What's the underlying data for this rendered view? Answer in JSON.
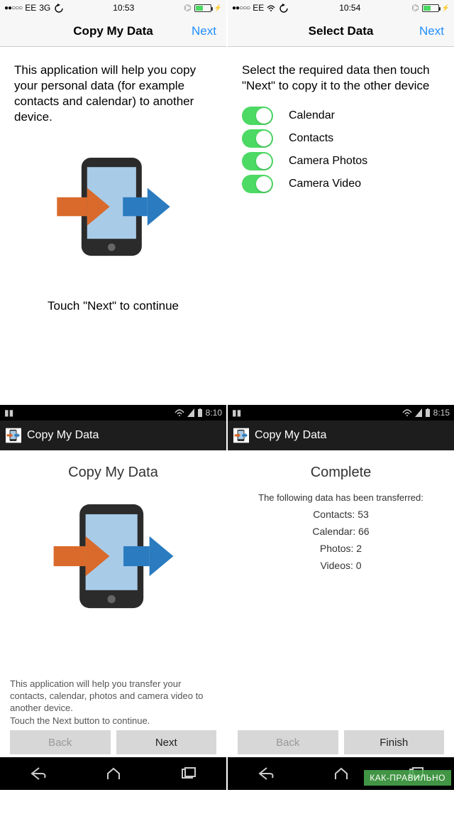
{
  "ios": {
    "left": {
      "status": {
        "carrier": "EE",
        "net": "3G",
        "time": "10:53",
        "signal": "●●○○○"
      },
      "nav": {
        "title": "Copy My Data",
        "next": "Next"
      },
      "intro": "This application will help you copy your personal data (for example contacts and calendar) to another device.",
      "touch_next": "Touch \"Next\" to continue"
    },
    "right": {
      "status": {
        "carrier": "EE",
        "time": "10:54",
        "signal": "●●○○○"
      },
      "nav": {
        "title": "Select Data",
        "next": "Next"
      },
      "intro": "Select the required data then touch \"Next\" to copy it to the other device",
      "items": [
        {
          "label": "Calendar"
        },
        {
          "label": "Contacts"
        },
        {
          "label": "Camera Photos"
        },
        {
          "label": "Camera Video"
        }
      ]
    }
  },
  "android": {
    "left": {
      "status_time": "8:10",
      "header": "Copy My Data",
      "title": "Copy My Data",
      "desc": "This application will help you transfer your contacts, calendar, photos and camera video to another device.",
      "desc2": "Touch the Next button to continue.",
      "back": "Back",
      "next": "Next"
    },
    "right": {
      "status_time": "8:15",
      "header": "Copy My Data",
      "title": "Complete",
      "transferred_label": "The following data has been transferred:",
      "results": {
        "contacts": "Contacts: 53",
        "calendar": "Calendar: 66",
        "photos": "Photos: 2",
        "videos": "Videos: 0"
      },
      "back": "Back",
      "finish": "Finish"
    }
  },
  "watermark": "КАК-ПРАВИЛЬНО"
}
